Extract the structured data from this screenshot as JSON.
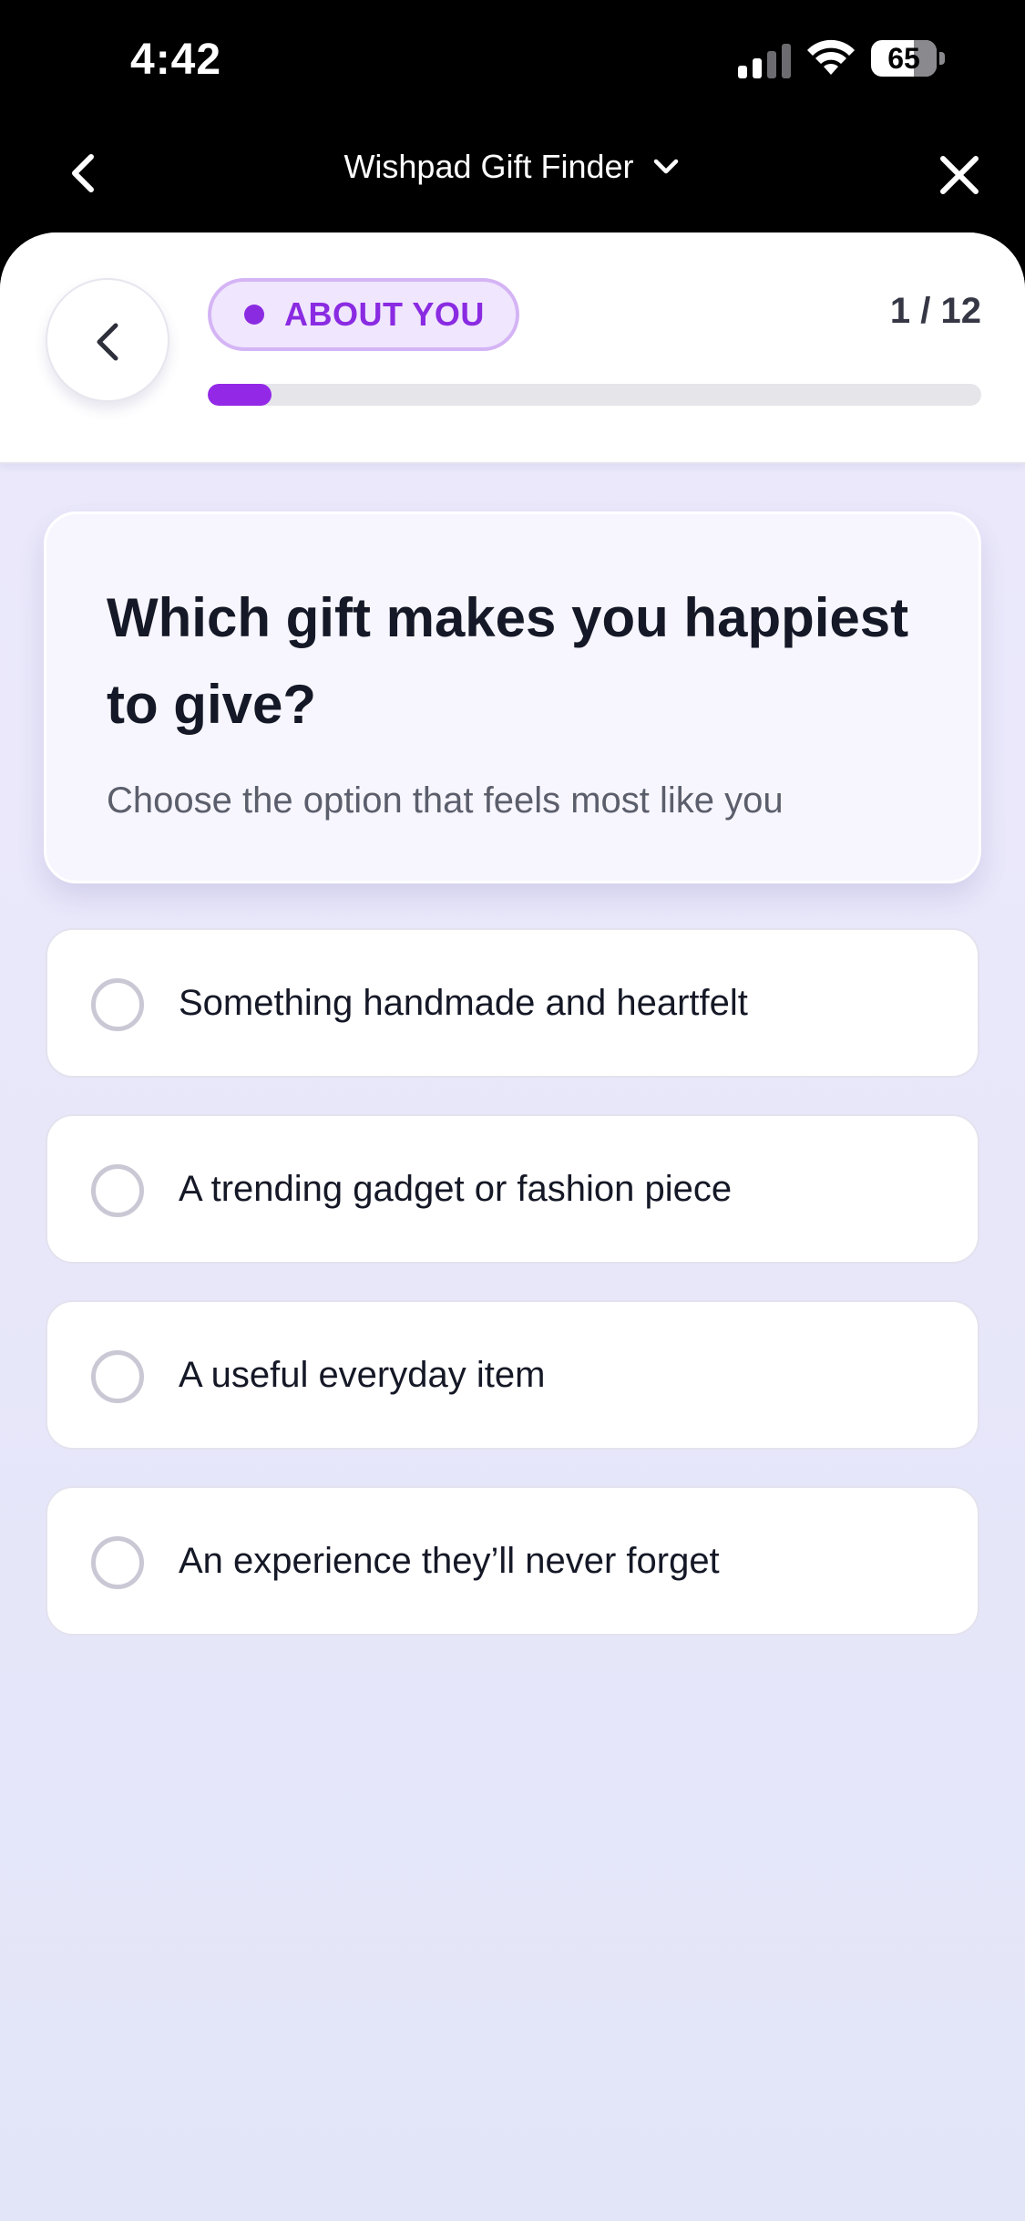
{
  "status_bar": {
    "time": "4:42",
    "battery": "65",
    "battery_fraction": 0.65
  },
  "nav": {
    "title": "Wishpad Gift Finder",
    "back_icon": "chevron-left-icon",
    "dropdown_icon": "chevron-down-icon",
    "close_icon": "close-icon"
  },
  "header": {
    "section_label": "ABOUT YOU",
    "step_counter": "1 / 12",
    "progress_fraction": 0.083
  },
  "question": {
    "title": "Which gift makes you happiest to give?",
    "subtitle": "Choose the option that feels most like you"
  },
  "options": [
    {
      "label": "Something handmade and heartfelt"
    },
    {
      "label": "A trending gadget or fashion piece"
    },
    {
      "label": "A useful everyday item"
    },
    {
      "label": "An experience they’ll never forget"
    }
  ],
  "colors": {
    "accent": "#9329e6",
    "pill_bg": "#f0e6fd",
    "pill_border": "#d4b4f5",
    "background": "#ece9fb"
  }
}
